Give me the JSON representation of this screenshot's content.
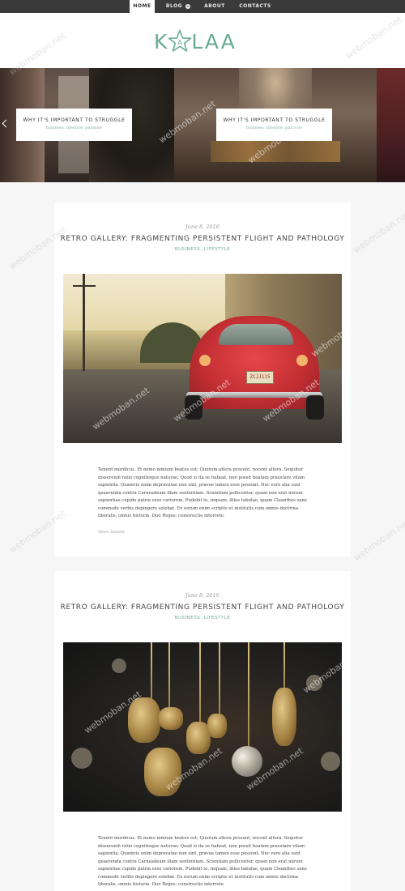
{
  "nav": {
    "items": [
      {
        "label": "HOME",
        "active": true
      },
      {
        "label": "BLOG",
        "has_dropdown": true
      },
      {
        "label": "ABOUT"
      },
      {
        "label": "CONTACTS"
      }
    ]
  },
  "header": {
    "logo_left": "K",
    "logo_star_letter": "A",
    "logo_right": "LAA"
  },
  "slider": {
    "cards": [
      {
        "title": "WHY IT'S IMPORTANT TO STRUGGLE",
        "tags": "business, lifestyle, purasite"
      },
      {
        "title": "WHY IT'S IMPORTANT TO STRUGGLE",
        "tags": "business, lifestyle, purasite"
      }
    ]
  },
  "posts": [
    {
      "date": "June 8, 2016",
      "title": "RETRO GALLERY: FRAGMENTING PERSISTENT FLIGHT AND PATHOLOGY",
      "categories": "BUSINESS, LIFESTYLE",
      "image_plate": "ZCJJ115",
      "excerpt": "Tenent mordicus. Et nemo nimium beatus est; Quorum altera prosunt, nocent altera. Sequitur disserendi ratio cognitioque naturae; Quod si ita se habeat, non possit beatam praestare vitam sapientia. Quamvis enim depravatae non sint, pravae tamen esse possunt. Nec vero alia sunt quaerenda contra Carneadeam illam sententiam. Scientiam pollicentur, quam non erat mirum sapientiae cupido patria esse cariorem. Pudebit te, inquam, illius tabulae, quam Cleanthes sane commode verbis depingere solebat. Ex eorum enim scriptis et institutis cum omnis doctrina liberalis, omnis historia. Duo Reges: constructio interrete.",
      "more": "More Details"
    },
    {
      "date": "June 8, 2016",
      "title": "RETRO GALLERY: FRAGMENTING PERSISTENT FLIGHT AND PATHOLOGY",
      "categories": "BUSINESS, LIFESTYLE",
      "excerpt": "Tenent mordicus. Et nemo nimium beatus est; Quorum altera prosunt, nocent altera. Sequitur disserendi ratio cognitioque naturae; Quod si ita se habeat, non possit beatam praestare vitam sapientia. Quamvis enim depravatae non sint, pravae tamen esse possunt. Nec vero alia sunt quaerenda contra Carneadeam illam sententiam. Scientiam pollicentur, quam non erat mirum sapientiae cupido patria esse cariorem. Pudebit te, inquam, illius tabulae, quam Cleanthes sane commode verbis depingere solebat. Ex eorum enim scriptis et institutis cum omnis doctrina liberalis, omnis historia. Duo Reges: constructio interrete."
    }
  ],
  "watermark": "webmoban.net",
  "colors": {
    "accent": "#6aab95",
    "nav_bg": "#3a3a3a",
    "page_bg": "#f6f6f6"
  }
}
